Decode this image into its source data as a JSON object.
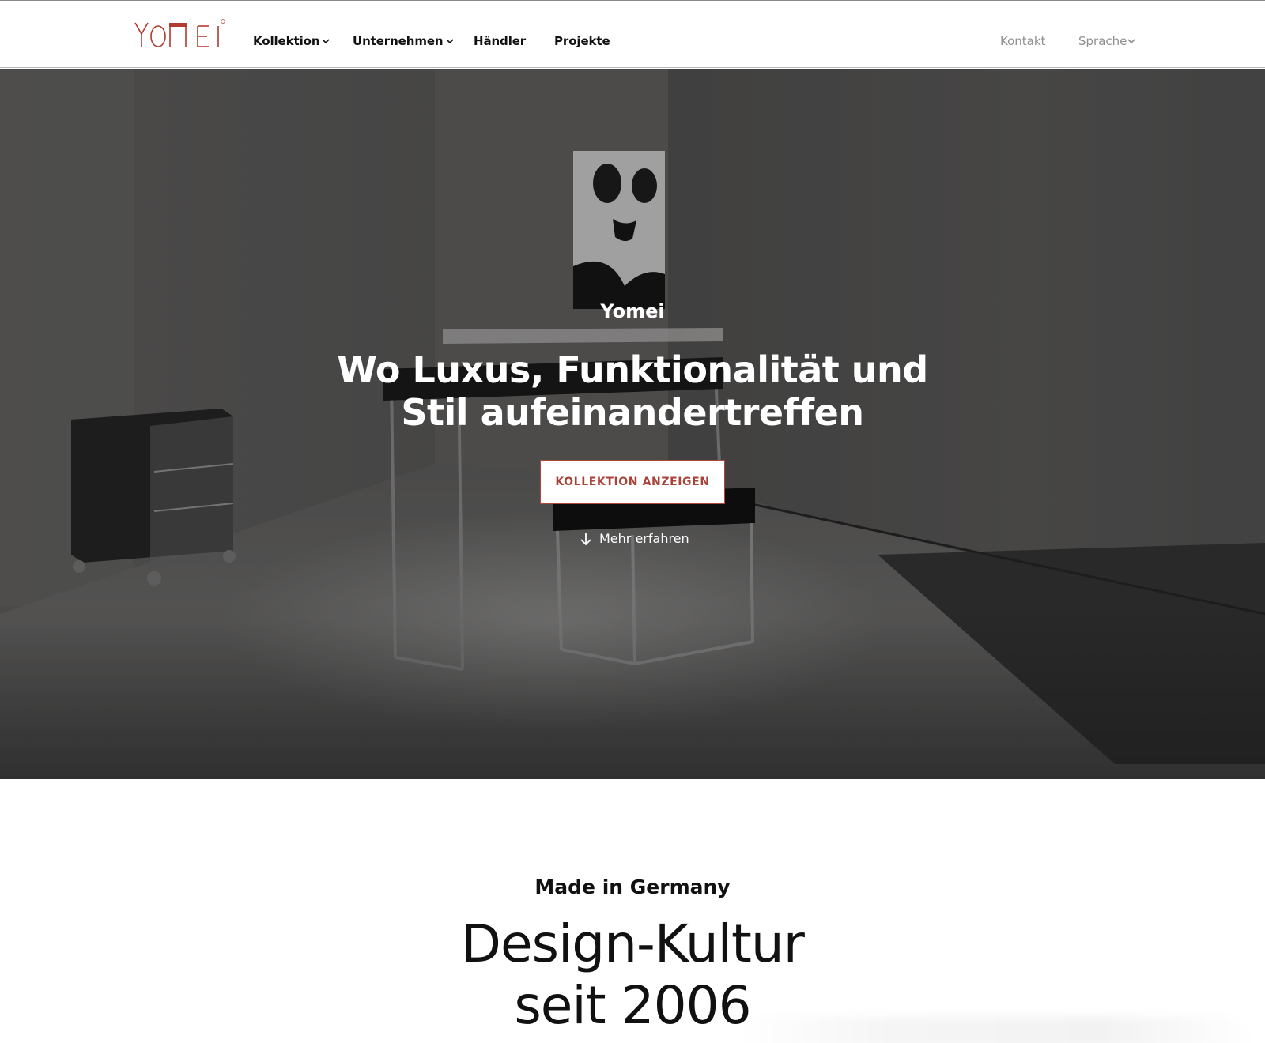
{
  "header": {
    "logo_text": "YOMEI",
    "brand_color": "#b23a2f",
    "nav": [
      {
        "label": "Kollektion",
        "has_dropdown": true
      },
      {
        "label": "Unternehmen",
        "has_dropdown": true
      },
      {
        "label": "Händler",
        "has_dropdown": false
      },
      {
        "label": "Projekte",
        "has_dropdown": false
      }
    ],
    "contact": "Kontakt",
    "language": "Sprache"
  },
  "hero": {
    "eyebrow": "Yomei",
    "headline": "Wo Luxus, Funktionalität und Stil aufeinandertreffen",
    "cta": "KOLLEKTION ANZEIGEN",
    "more": "Mehr erfahren",
    "more_icon": "arrow-down-icon",
    "cta_color": "#a8433a"
  },
  "section": {
    "eyebrow": "Made in Germany",
    "title_line1": "Design-Kultur",
    "title_line2": "seit 2006"
  }
}
